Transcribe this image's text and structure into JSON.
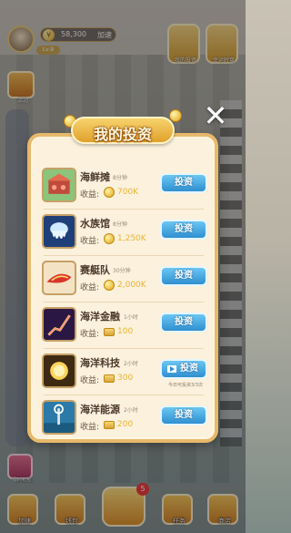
{
  "hud": {
    "level": "Lv.9",
    "coins": "58,300",
    "coins_badge": "加速",
    "my_investment_label": "我的投资",
    "lottery_label": "幸运转盘",
    "event_label": "活动"
  },
  "modal": {
    "title": "我的投资",
    "close_symbol": "✕",
    "income_label": "收益:",
    "items": [
      {
        "name": "海鲜摊",
        "time": "8分钟",
        "income": "700K",
        "income_type": "coin",
        "button": "投资",
        "video": false,
        "note": ""
      },
      {
        "name": "水族馆",
        "time": "8分钟",
        "income": "1,250K",
        "income_type": "coin",
        "button": "投资",
        "video": false,
        "note": ""
      },
      {
        "name": "赛艇队",
        "time": "30分钟",
        "income": "2,000K",
        "income_type": "coin",
        "button": "投资",
        "video": false,
        "note": ""
      },
      {
        "name": "海洋金融",
        "time": "1小时",
        "income": "100",
        "income_type": "cash",
        "button": "投资",
        "video": false,
        "note": ""
      },
      {
        "name": "海洋科技",
        "time": "2小时",
        "income": "300",
        "income_type": "cash",
        "button": "投资",
        "video": true,
        "note": "今日可投资3/3次"
      },
      {
        "name": "海洋能源",
        "time": "2小时",
        "income": "200",
        "income_type": "cash",
        "button": "投资",
        "video": false,
        "note": ""
      }
    ]
  },
  "side": {
    "bottom_left_label": "限时礼包"
  },
  "nav": {
    "items": [
      "加速",
      "钱包",
      "",
      "任务",
      "商店"
    ],
    "center_badge": "5"
  },
  "colors": {
    "modal_bg": "#fbf1dc",
    "modal_border": "#e7b96b",
    "invest_button": "#2f8fd0",
    "income_value": "#e9b430",
    "title_ribbon": "#e0a12c"
  }
}
